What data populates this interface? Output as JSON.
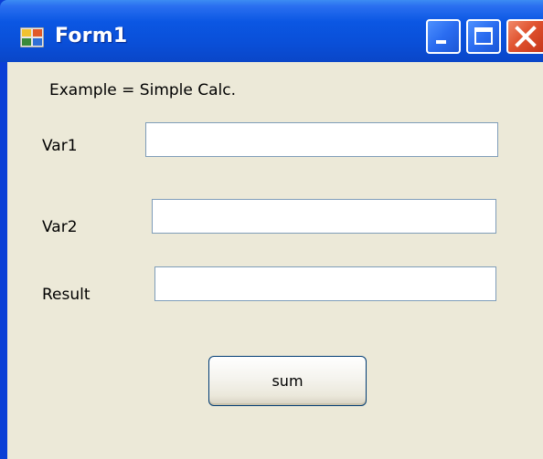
{
  "window": {
    "title": "Form1",
    "icon": "form-app-icon",
    "controls": [
      "minimize-icon",
      "maximize-icon",
      "close-icon"
    ]
  },
  "form": {
    "heading": "Example = Simple Calc.",
    "var1": {
      "label": "Var1",
      "value": ""
    },
    "var2": {
      "label": "Var2",
      "value": ""
    },
    "result": {
      "label": "Result",
      "value": ""
    },
    "sum_button": "sum"
  },
  "colors": {
    "titlebar": "#0a4fd8",
    "client_bg": "#ece9d8",
    "close_button": "#e0532f",
    "textbox_border": "#7f9db9"
  }
}
